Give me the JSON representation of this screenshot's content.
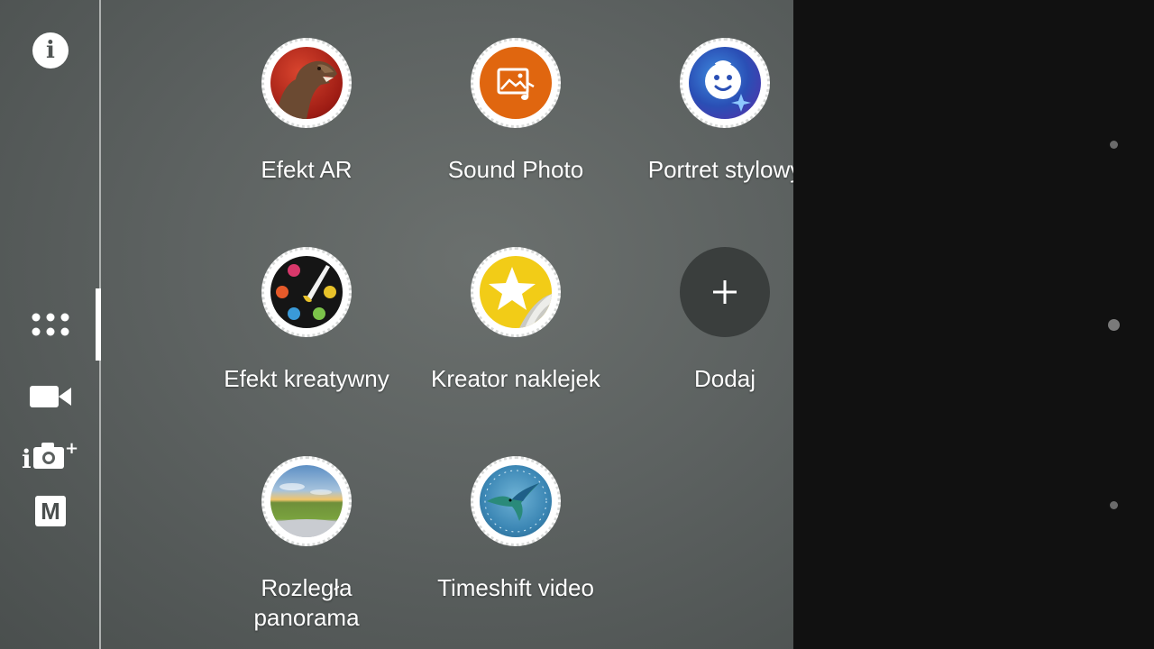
{
  "sidebar": {
    "info_glyph": "i",
    "manual_mode_label": "M",
    "icons": [
      "info-icon",
      "apps-grid-icon",
      "video-camera-icon",
      "superior-auto-camera-icon",
      "manual-mode-icon"
    ]
  },
  "apps": [
    {
      "label": "Efekt AR",
      "icon": "dinosaur-ar-icon"
    },
    {
      "label": "Sound Photo",
      "icon": "sound-photo-icon"
    },
    {
      "label": "Portret stylowy",
      "icon": "style-portrait-icon"
    },
    {
      "label": "Efekt kreatywny",
      "icon": "creative-effect-palette-icon"
    },
    {
      "label": "Kreator naklejek",
      "icon": "sticker-creator-icon"
    },
    {
      "label": "Dodaj",
      "icon": "plus-icon"
    },
    {
      "label": "Rozległa\npanorama",
      "icon": "panorama-icon"
    },
    {
      "label": "Timeshift video",
      "icon": "hummingbird-timeshift-icon"
    }
  ],
  "page_indicator": {
    "count": 3,
    "active_index": 1
  },
  "colors": {
    "panel_bg": "#5d6261",
    "right_bg": "#111111",
    "sound_photo_orange": "#e0660f",
    "sticker_yellow": "#f2cc17",
    "add_button_bg": "#3a3e3d"
  }
}
